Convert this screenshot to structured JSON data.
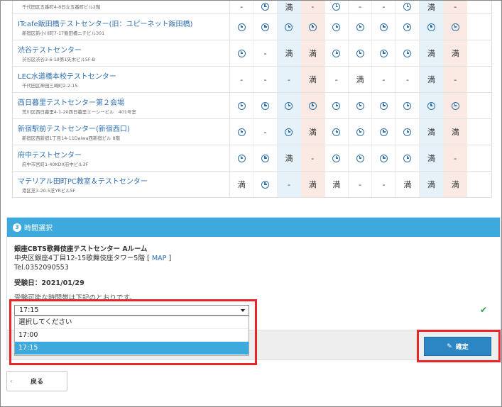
{
  "centers": [
    {
      "name": "",
      "address": "千代田区五番町4-8日立五番町ビル2階",
      "cells": [
        "-",
        "clock",
        "満",
        "-",
        "clock",
        "-",
        "-",
        "clock",
        "満",
        "-"
      ]
    },
    {
      "name": "ITcafe飯田橋テストセンター(旧：ユピーネット飯田橋)",
      "address": "新宿区新小川町7-17飯田橋ニチビル301",
      "cells": [
        "clock",
        "clock",
        "clock",
        "clock",
        "clock",
        "clock",
        "clock",
        "clock",
        "clock",
        "clock"
      ]
    },
    {
      "name": "渋谷テストセンター",
      "address": "渋谷区渋谷3-6-19第1矢木ビル5F-B",
      "cells": [
        "clock",
        "-",
        "満",
        "満",
        "clock",
        "clock",
        "clock",
        "clock",
        "満",
        "満"
      ]
    },
    {
      "name": "LEC水道橋本校テストセンター",
      "address": "千代田区神田三崎町2-2-15",
      "cells": [
        "-",
        "-",
        "-",
        "満",
        "-",
        "満",
        "-",
        "-",
        "満",
        "-"
      ]
    },
    {
      "name": "西日暮里テストセンター第２会場",
      "address": "荒川区西日暮里4-1-20西日暮里エーシービル　401号室",
      "cells": [
        "clock",
        "clock",
        "clock",
        "clock",
        "clock",
        "clock",
        "clock",
        "clock",
        "clock",
        "clock"
      ]
    },
    {
      "name": "新宿駅前テストセンター(新宿西口)",
      "address": "新宿区西新宿1丁目14-11Daiwa西新宿ビル 8階",
      "cells": [
        "clock",
        "-",
        "clock",
        "満",
        "clock",
        "clock",
        "clock",
        "clock",
        "満",
        "満"
      ]
    },
    {
      "name": "府中テストセンター",
      "address": "府中市宮町1-40KDX府中ビル3F",
      "cells": [
        "clock",
        "clock",
        "満",
        "-",
        "clock",
        "clock",
        "clock",
        "clock",
        "満",
        "-"
      ]
    },
    {
      "name": "マテリアル田町PC教室＆テストセンター",
      "address": "港区芝3-20-5芝YRビル5F",
      "cells": [
        "満",
        "clock",
        "-",
        "満",
        "満",
        "-",
        "-",
        "満",
        "満",
        "満"
      ]
    }
  ],
  "time_section": {
    "step_number": "3",
    "title": "時間選択",
    "venue_name": "銀座CBTS歌舞伎座テストセンター Aルーム",
    "address": "中央区銀座4丁目12-15歌舞伎座タワー5階",
    "map_label": "MAP",
    "tel": "Tel.0352090553",
    "exam_date": "受験日：2021/01/29",
    "available_note": "受験可能な時間帯は下記のとおりです。",
    "select_value": "17:15",
    "options": [
      "選択してください",
      "17:00",
      "17:15"
    ]
  },
  "buttons": {
    "confirm_label": "確定",
    "back_label": "戻る"
  },
  "colors": {
    "header_blue": "#3ea9dd",
    "button_blue": "#2d86c4",
    "highlight_red": "#e8262a",
    "check_green": "#2e9e48"
  }
}
